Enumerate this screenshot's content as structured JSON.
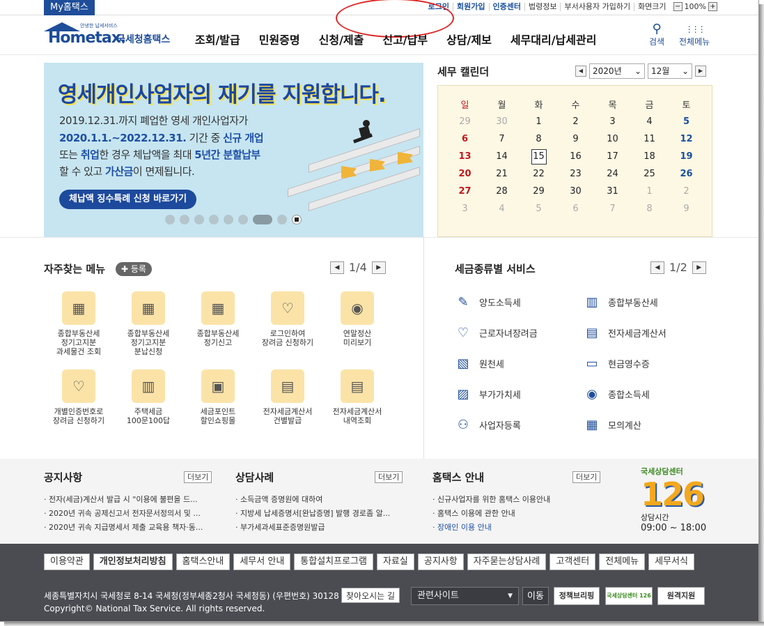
{
  "topbar": {
    "myhometax": "My홈택스",
    "links": [
      "로그인",
      "회원가입",
      "인증센터",
      "법령정보",
      "부서사용자 가입하기",
      "화면크기"
    ],
    "zoom": "100%",
    "zoom_minus": "−",
    "zoom_plus": "+"
  },
  "header": {
    "logo_main": "Hometax.",
    "logo_sub": "국세청홈택스",
    "logo_tiny": "안녕한 납세서비스",
    "menu": [
      "조회/발급",
      "민원증명",
      "신청/제출",
      "신고/납부",
      "상담/제보",
      "세무대리/납세관리"
    ],
    "search_label": "검색",
    "allmenu_label": "전체메뉴",
    "search_glyph": "⚲",
    "allmenu_glyph": "⋮⋮⋮"
  },
  "banner": {
    "headline": "영세개인사업자의 재기를 지원합니다.",
    "line1": "2019.12.31.까지 폐업한 영세 개인사업자가",
    "line2a": "2020.1.1.~2022.12.31.",
    "line2b": " 기간 중 ",
    "line2c": "신규 개업",
    "line3a": "또는 ",
    "line3b": "취업",
    "line3c": "한 경우 체납액을 최대 ",
    "line3d": "5년간 분할납부",
    "line4a": "할 수 있고 ",
    "line4b": "가산금",
    "line4c": "이 면제됩니다.",
    "button": "체납액 징수특례 신청 바로가기",
    "colors": {
      "bg": "#c6e5f1",
      "accent": "#1d4a9d"
    }
  },
  "calendar": {
    "title": "세무 캘린더",
    "year": "2020년",
    "month": "12월",
    "weekdays": [
      "일",
      "월",
      "화",
      "수",
      "목",
      "금",
      "토"
    ],
    "rows": [
      [
        "29",
        "30",
        "1",
        "2",
        "3",
        "4",
        "5"
      ],
      [
        "6",
        "7",
        "8",
        "9",
        "10",
        "11",
        "12"
      ],
      [
        "13",
        "14",
        "15",
        "16",
        "17",
        "18",
        "19"
      ],
      [
        "20",
        "21",
        "22",
        "23",
        "24",
        "25",
        "26"
      ],
      [
        "27",
        "28",
        "29",
        "30",
        "31",
        "1",
        "2"
      ],
      [
        "3",
        "4",
        "5",
        "6",
        "7",
        "8",
        "9"
      ]
    ],
    "today": "15",
    "prev_glyph": "◀",
    "next_glyph": "▶"
  },
  "favorites": {
    "title": "자주찾는 메뉴",
    "register": "✚ 등록",
    "page": "1/4",
    "prev_glyph": "◀",
    "next_glyph": "▶",
    "items": [
      {
        "label": "종합부동산세\n정기고지분\n과세물건 조회",
        "icon": "calendar-check-icon",
        "glyph": "▦"
      },
      {
        "label": "종합부동산세\n정기고지분\n분납신청",
        "icon": "calendar-check-icon",
        "glyph": "▦"
      },
      {
        "label": "종합부동산세\n정기신고",
        "icon": "calendar-edit-icon",
        "glyph": "▦"
      },
      {
        "label": "로그인하여\n장려금 신청하기",
        "icon": "heart-pen-icon",
        "glyph": "♡"
      },
      {
        "label": "연말정산\n미리보기",
        "icon": "money-bag-icon",
        "glyph": "◉"
      },
      {
        "label": "개별인증번호로\n장려금 신청하기",
        "icon": "heart-pen-icon",
        "glyph": "♡"
      },
      {
        "label": "주택세금\n100문100답",
        "icon": "building-icon",
        "glyph": "▥"
      },
      {
        "label": "세금포인트\n할인쇼핑몰",
        "icon": "tax-bag-icon",
        "glyph": "▣"
      },
      {
        "label": "전자세금계산서\n건별발급",
        "icon": "calculator-icon",
        "glyph": "▤"
      },
      {
        "label": "전자세금계산서\n내역조회",
        "icon": "search-doc-icon",
        "glyph": "▤"
      }
    ]
  },
  "taxservice": {
    "title": "세금종류별 서비스",
    "page": "1/2",
    "prev_glyph": "◀",
    "next_glyph": "▶",
    "items": [
      {
        "label": "양도소득세",
        "icon": "document-pen-icon",
        "glyph": "✎"
      },
      {
        "label": "종합부동산세",
        "icon": "building-icon",
        "glyph": "▥"
      },
      {
        "label": "근로자녀장려금",
        "icon": "heart-icon",
        "glyph": "♡"
      },
      {
        "label": "전자세금계산서",
        "icon": "calculator-icon",
        "glyph": "▤"
      },
      {
        "label": "원천세",
        "icon": "salary-doc-icon",
        "glyph": "▧"
      },
      {
        "label": "현금영수증",
        "icon": "receipt-icon",
        "glyph": "▭"
      },
      {
        "label": "부가가치세",
        "icon": "vat-doc-icon",
        "glyph": "▨"
      },
      {
        "label": "종합소득세",
        "icon": "money-bag-icon",
        "glyph": "◉"
      },
      {
        "label": "사업자등록",
        "icon": "person-icon",
        "glyph": "⚇"
      },
      {
        "label": "모의계산",
        "icon": "calculator-icon",
        "glyph": "▦"
      }
    ]
  },
  "notice": {
    "title": "공지사항",
    "more": "더보기",
    "items": [
      "전자(세금)계산서 발급 시 \"이용에 불편을 드...",
      "2020년 귀속 공제신고서 전자문서정의서 및 ...",
      "2020년 귀속 지급명세서 제출 교육용 책자·동..."
    ]
  },
  "cases": {
    "title": "상담사례",
    "more": "더보기",
    "items": [
      "소득금액 증명원에 대하여",
      "지방세 납세증명서[완납증명] 발행 경로좀 알...",
      "부가세과세표준증명원발급"
    ]
  },
  "guide": {
    "title": "홈택스 안내",
    "more": "더보기",
    "items": [
      "신규사업자를 위한 홈택스 이용안내",
      "홈택스 이용에 관한 안내",
      "장애인 이용 안내"
    ]
  },
  "center": {
    "title": "국세상담센터",
    "number": "126",
    "hours_label": "상담시간",
    "hours": "09:00 ~ 18:00"
  },
  "footer": {
    "links": [
      "이용약관",
      "개인정보처리방침",
      "홈택스안내",
      "세무서 안내",
      "통합설치프로그램",
      "자료실",
      "공지사항",
      "자주묻는상담사례",
      "고객센터",
      "전체메뉴",
      "세무서식"
    ],
    "address": "세종특별자치시 국세청로 8-14 국세청(정부세종2청사 국세청동) (우편번호) 30128",
    "find": "찾아오시는 길",
    "copyright": "Copyright© National Tax Service. All rights reserved.",
    "related": "관련사이트",
    "related_glyph": "▼",
    "go": "이동",
    "banners": [
      "정책브리핑",
      "국세상담센터 126",
      "원격지원"
    ]
  }
}
